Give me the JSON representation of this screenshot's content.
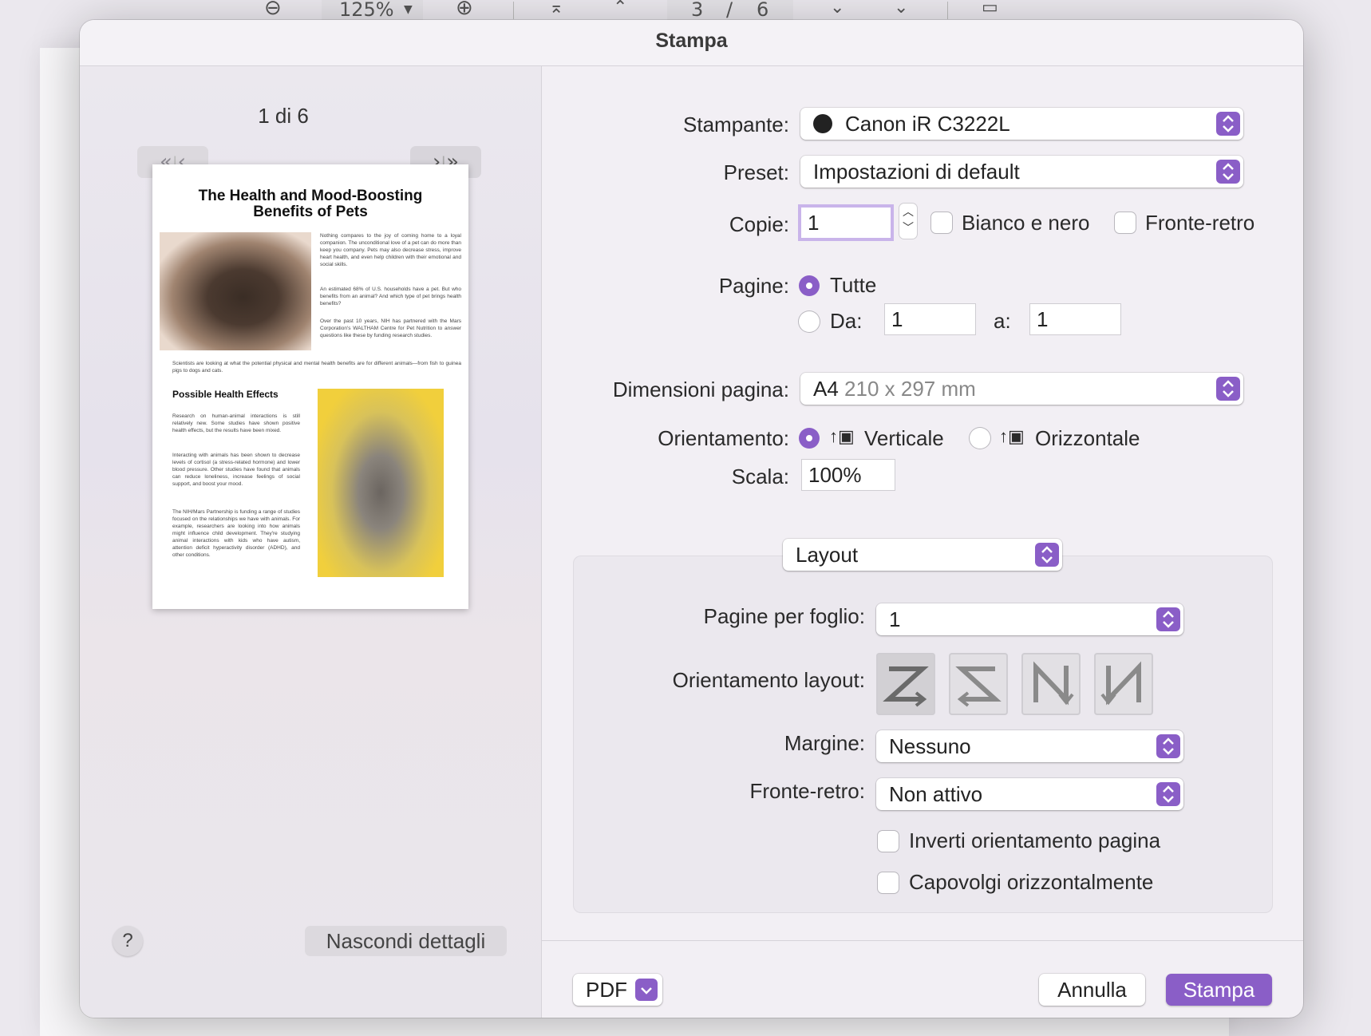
{
  "toolbar": {
    "zoom_out_icon": "minus-circle-icon",
    "zoom": "125%",
    "zoom_in_icon": "plus-circle-icon",
    "page_current": "3",
    "page_sep": "/",
    "page_total": "6"
  },
  "dialog": {
    "title": "Stampa"
  },
  "preview": {
    "page_indicator": "1 di 6",
    "doc_title_line1": "The Health and Mood-Boosting",
    "doc_title_line2": "Benefits of Pets",
    "para1": "Nothing compares to the joy of coming home to a loyal companion. The unconditional love of a pet can do more than keep you company. Pets may also decrease stress, improve heart health, and even help children with their emotional and social skills.",
    "para2": "An estimated 68% of U.S. households have a pet. But who benefits from an animal? And which type of pet brings health benefits?",
    "para3": "Over the past 10 years, NIH has partnered with the Mars Corporation's WALTHAM Centre for Pet Nutrition to answer questions like these by funding research studies.",
    "para4": "Scientists are looking at what the potential physical and mental health benefits are for different animals—from fish to guinea pigs to dogs and cats.",
    "heading2": "Possible Health Effects",
    "para5": "Research on human-animal interactions is still relatively new. Some studies have shown positive health effects, but the results have been mixed.",
    "para6": "Interacting with animals has been shown to decrease levels of cortisol (a stress-related hormone) and lower blood pressure. Other studies have found that animals can reduce loneliness, increase feelings of social support, and boost your mood.",
    "para7": "The NIH/Mars Partnership is funding a range of studies focused on the relationships we have with animals. For example, researchers are looking into how animals might influence child development. They're studying animal interactions with kids who have autism, attention deficit hyperactivity disorder (ADHD), and other conditions."
  },
  "left_footer": {
    "help": "?",
    "hide_details": "Nascondi dettagli"
  },
  "form": {
    "printer_label": "Stampante:",
    "printer_value": "Canon iR C3222L",
    "preset_label": "Preset:",
    "preset_value": "Impostazioni di default",
    "copies_label": "Copie:",
    "copies_value": "1",
    "bw_label": "Bianco e nero",
    "duplex_label": "Fronte-retro",
    "pages_label": "Pagine:",
    "pages_all": "Tutte",
    "pages_from_label": "Da:",
    "pages_from_value": "1",
    "pages_to_label": "a:",
    "pages_to_value": "1",
    "size_label": "Dimensioni pagina:",
    "size_value": "A4",
    "size_detail": "210 x 297 mm",
    "orient_label": "Orientamento:",
    "orient_portrait": "Verticale",
    "orient_landscape": "Orizzontale",
    "scale_label": "Scala:",
    "scale_value": "100%",
    "section_value": "Layout"
  },
  "layout": {
    "pps_label": "Pagine per foglio:",
    "pps_value": "1",
    "direction_label": "Orientamento layout:",
    "border_label": "Margine:",
    "border_value": "Nessuno",
    "twosided_label": "Fronte-retro:",
    "twosided_value": "Non attivo",
    "reverse_label": "Inverti orientamento pagina",
    "flip_label": "Capovolgi orizzontalmente"
  },
  "footer": {
    "pdf": "PDF",
    "cancel": "Annulla",
    "print": "Stampa"
  },
  "colors": {
    "accent": "#8a5ec7"
  }
}
